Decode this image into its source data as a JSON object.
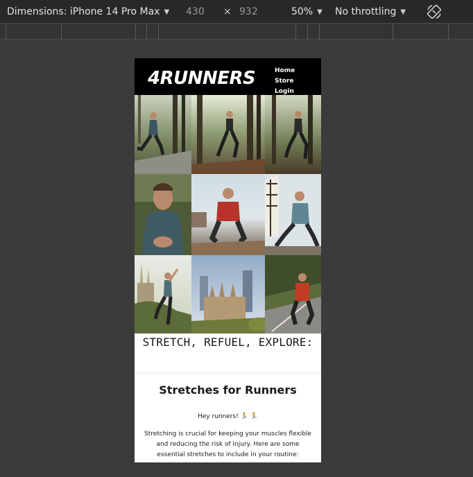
{
  "devtools": {
    "dimensions_label": "Dimensions: iPhone 14 Pro Max",
    "width": "430",
    "times": "×",
    "height": "932",
    "zoom": "50%",
    "throttling": "No throttling",
    "rotate_icon": "rotate-icon"
  },
  "site": {
    "logo": "4RUNNERS",
    "nav": [
      "Home",
      "Store",
      "Login"
    ],
    "tagline": "STRETCH, REFUEL, EXPLORE:",
    "card_title": "Stretches for Runners",
    "greeting": "Hey runners! 🏃 🏃",
    "intro": "Stretching is crucial for keeping your muscles flexible and reducing the risk of injury. Here are some essential stretches to include in your routine:"
  },
  "colors": {
    "header_bg": "#000000",
    "page_bg": "#3b3b3b",
    "toolbar_bg": "#282828"
  }
}
